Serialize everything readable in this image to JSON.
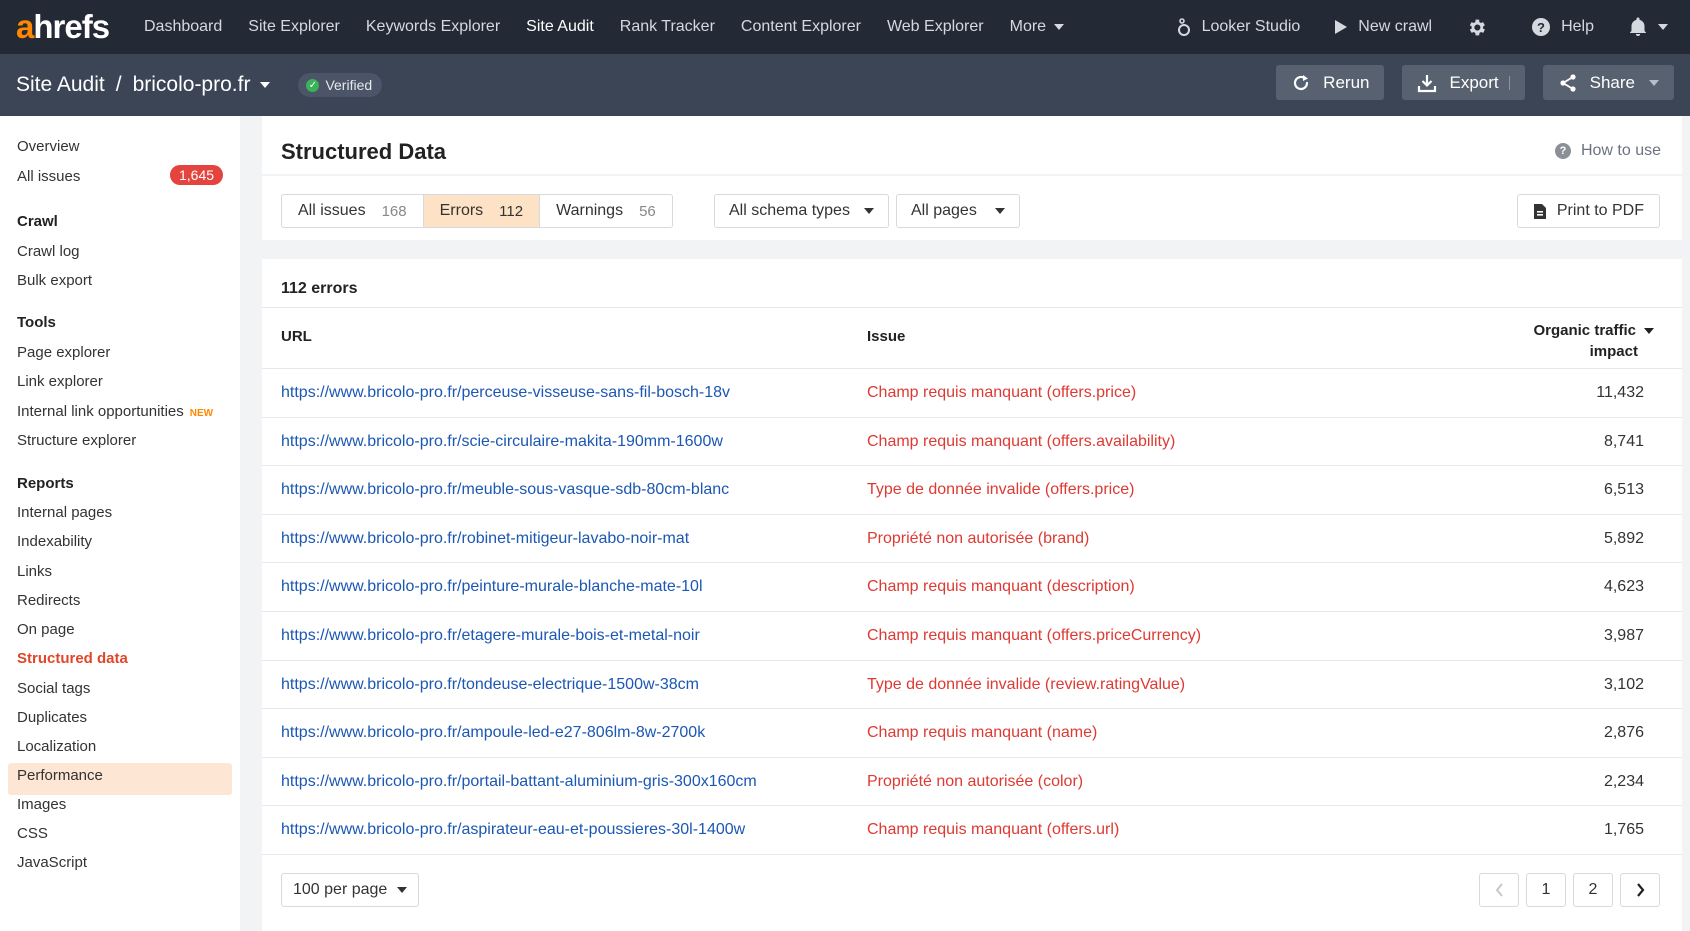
{
  "topnav": {
    "logo_a": "a",
    "logo_rest": "hrefs",
    "items": [
      "Dashboard",
      "Site Explorer",
      "Keywords Explorer",
      "Site Audit",
      "Rank Tracker",
      "Content Explorer",
      "Web Explorer"
    ],
    "active_index": 3,
    "more_label": "More",
    "looker_label": "Looker Studio",
    "new_crawl_label": "New crawl",
    "help_label": "Help"
  },
  "subheader": {
    "section": "Site Audit",
    "separator": "/",
    "project": "bricolo-pro.fr",
    "verified_label": "Verified",
    "rerun_label": "Rerun",
    "export_label": "Export",
    "share_label": "Share"
  },
  "sidebar": {
    "overview": "Overview",
    "all_issues": "All issues",
    "all_issues_count": "1,645",
    "crawl_heading": "Crawl",
    "crawl_items": [
      "Crawl log",
      "Bulk export"
    ],
    "tools_heading": "Tools",
    "tools_items": [
      "Page explorer",
      "Link explorer",
      "Internal link opportunities",
      "Structure explorer"
    ],
    "new_badge": "NEW",
    "reports_heading": "Reports",
    "reports_items": [
      "Internal pages",
      "Indexability",
      "Links",
      "Redirects",
      "On page",
      "Structured data",
      "Social tags",
      "Duplicates",
      "Localization",
      "Performance",
      "Images",
      "CSS",
      "JavaScript"
    ],
    "active_report": "Structured data"
  },
  "main": {
    "title": "Structured Data",
    "how_to_use": "How to use",
    "filters": {
      "tabs": [
        {
          "label": "All issues",
          "count": "168"
        },
        {
          "label": "Errors",
          "count": "112"
        },
        {
          "label": "Warnings",
          "count": "56"
        }
      ],
      "active_tab": 1,
      "schema_dropdown": "All schema types",
      "pages_dropdown": "All pages",
      "print_label": "Print to PDF"
    },
    "table": {
      "count_label": "112 errors",
      "col_url": "URL",
      "col_issue": "Issue",
      "col_impact_line1": "Organic traffic",
      "col_impact_line2": "impact",
      "rows": [
        {
          "url": "https://www.bricolo-pro.fr/perceuse-visseuse-sans-fil-bosch-18v",
          "issue": "Champ requis manquant (offers.price)",
          "impact": "11,432"
        },
        {
          "url": "https://www.bricolo-pro.fr/scie-circulaire-makita-190mm-1600w",
          "issue": "Champ requis manquant (offers.availability)",
          "impact": "8,741"
        },
        {
          "url": "https://www.bricolo-pro.fr/meuble-sous-vasque-sdb-80cm-blanc",
          "issue": "Type de donnée invalide (offers.price)",
          "impact": "6,513"
        },
        {
          "url": "https://www.bricolo-pro.fr/robinet-mitigeur-lavabo-noir-mat",
          "issue": "Propriété non autorisée (brand)",
          "impact": "5,892"
        },
        {
          "url": "https://www.bricolo-pro.fr/peinture-murale-blanche-mate-10l",
          "issue": "Champ requis manquant (description)",
          "impact": "4,623"
        },
        {
          "url": "https://www.bricolo-pro.fr/etagere-murale-bois-et-metal-noir",
          "issue": "Champ requis manquant (offers.priceCurrency)",
          "impact": "3,987"
        },
        {
          "url": "https://www.bricolo-pro.fr/tondeuse-electrique-1500w-38cm",
          "issue": "Type de donnée invalide (review.ratingValue)",
          "impact": "3,102"
        },
        {
          "url": "https://www.bricolo-pro.fr/ampoule-led-e27-806lm-8w-2700k",
          "issue": "Champ requis manquant (name)",
          "impact": "2,876"
        },
        {
          "url": "https://www.bricolo-pro.fr/portail-battant-aluminium-gris-300x160cm",
          "issue": "Propriété non autorisée (color)",
          "impact": "2,234"
        },
        {
          "url": "https://www.bricolo-pro.fr/aspirateur-eau-et-poussieres-30l-1400w",
          "issue": "Champ requis manquant (offers.url)",
          "impact": "1,765"
        }
      ]
    },
    "pagination": {
      "per_page": "100 per page",
      "pages": [
        "1",
        "2"
      ]
    }
  },
  "colors": {
    "topbar": "#242a35",
    "subbar": "#3b4556",
    "brand_orange": "#ff8800",
    "link_blue": "#1b57b3",
    "error_red": "#dd3a33",
    "active_tab_bg": "#fde2c6"
  }
}
